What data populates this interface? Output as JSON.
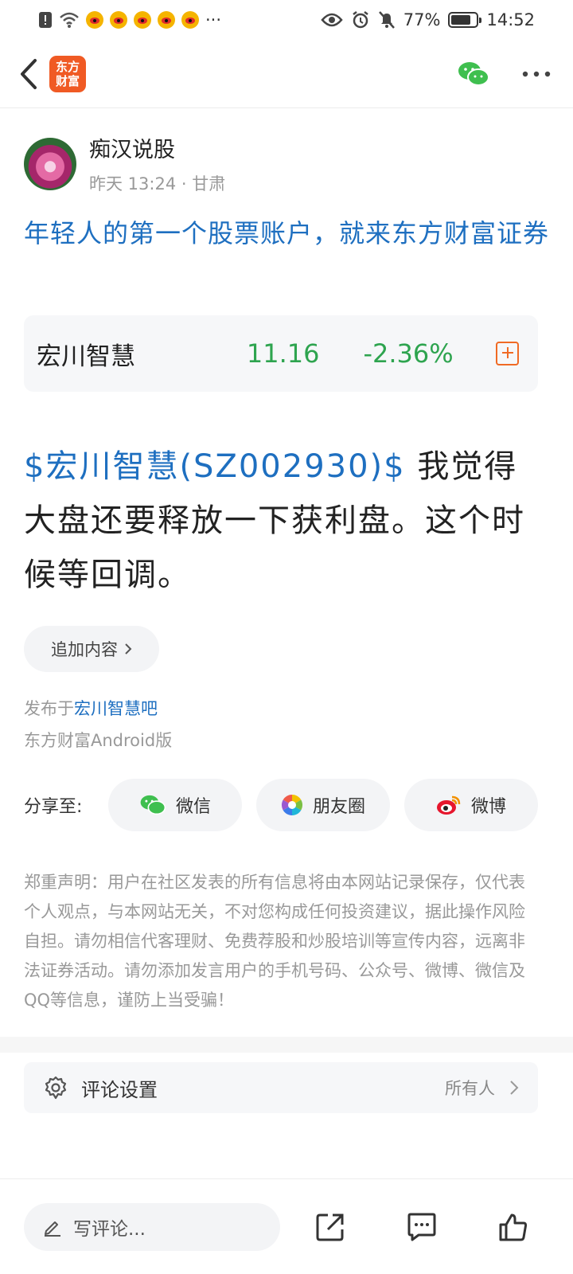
{
  "status_bar": {
    "battery": "77%",
    "time": "14:52",
    "more": "···"
  },
  "nav": {
    "logo_line1": "东方",
    "logo_line2": "财富"
  },
  "author": {
    "name": "痴汉说股",
    "meta": "昨天 13:24 · 甘肃"
  },
  "promo": {
    "text": "年轻人的第一个股票账户，就来东方财富证券"
  },
  "stock": {
    "name": "宏川智慧",
    "price": "11.16",
    "change": "-2.36%"
  },
  "post": {
    "tag": "$宏川智慧(SZ002930)$",
    "body": " 我觉得大盘还要释放一下获利盘。这个时候等回调。"
  },
  "append": {
    "label": "追加内容"
  },
  "published": {
    "prefix": "发布于",
    "bar": "宏川智慧吧",
    "platform": "东方财富Android版"
  },
  "share": {
    "label": "分享至:",
    "wechat": "微信",
    "moments": "朋友圈",
    "weibo": "微博"
  },
  "disclaimer": "郑重声明：用户在社区发表的所有信息将由本网站记录保存，仅代表个人观点，与本网站无关，不对您构成任何投资建议，据此操作风险自担。请勿相信代客理财、免费荐股和炒股培训等宣传内容，远离非法证券活动。请勿添加发言用户的手机号码、公众号、微博、微信及QQ等信息，谨防上当受骗！",
  "comment_settings": {
    "label": "评论设置",
    "value": "所有人"
  },
  "bottom": {
    "placeholder": "写评论..."
  },
  "colors": {
    "link": "#1e6fc0",
    "down": "#2ea44f",
    "brand": "#f05a24"
  }
}
